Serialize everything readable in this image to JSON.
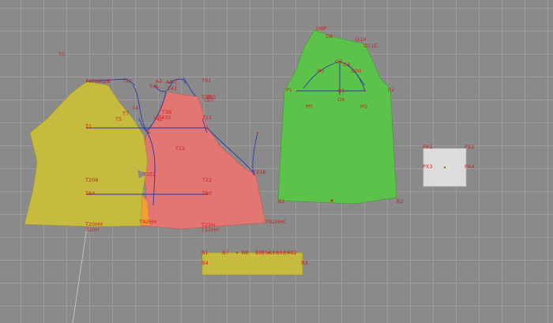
{
  "colors": {
    "background": "#8a8a8a",
    "grid": "#9c9c9c",
    "back_piece": "#c6bb3f",
    "front_piece": "#e27672",
    "sleeve_piece": "#5cc34a",
    "patch_piece": "#dcdcdc",
    "strip_piece": "#c6bb3f",
    "construction_line": "#2c3aa8",
    "label": "#cc2020"
  },
  "labels": {
    "t0": "Т0",
    "t6pl": "Т6",
    "t68sh": "Т68ШВ",
    "t47": "Т47",
    "a2": "А2",
    "t45": "Т45",
    "a4n": "А4П",
    "t41": "Т41",
    "t91": "Т91",
    "t58": "Т58",
    "t35": "Т35",
    "t5p": "Т5П",
    "t4": "Т4",
    "t7": "Т7",
    "t38": "Т38",
    "t42": "Т42",
    "t430": "Т430",
    "t1": "Т1",
    "t11": "Т11",
    "t5": "Т5",
    "t12": "Т12",
    "t208": "Т208",
    "t352": "Т352",
    "t22": "Т22",
    "t6a": "Т6А",
    "t60": "Т60",
    "t31b": "Т31В",
    "t20nn": "Т20НН",
    "t20n": "Т20Н",
    "t92nn": "Т92НН",
    "t92nns": "Т92ННС",
    "t22n": "Т22Н",
    "t22nn": "Т22НН",
    "o6p": "О6Р",
    "o8": "О8",
    "o14": "О14",
    "o11": "О11С",
    "o2": "О2",
    "o3": "О3",
    "p0": "Р0",
    "o00": "О00",
    "o1": "О1",
    "o4": "О4",
    "o2b": "О2",
    "r1": "Р1",
    "p2": "Р2",
    "pn": "РП",
    "po": "РО",
    "b1": "В1",
    "p": "Р",
    "b2": "В2",
    "px1": "РХ1",
    "px2": "РХ2",
    "px3": "РХ3",
    "px4": "РХ4",
    "v1": "В1",
    "v7": "В7",
    "v8": "В8",
    "v0": "В0",
    "v5": "В5",
    "v6": "В6",
    "v61": "В6",
    "v02": "В0",
    "v2": "В2",
    "v4": "В4",
    "v3": "В3"
  }
}
